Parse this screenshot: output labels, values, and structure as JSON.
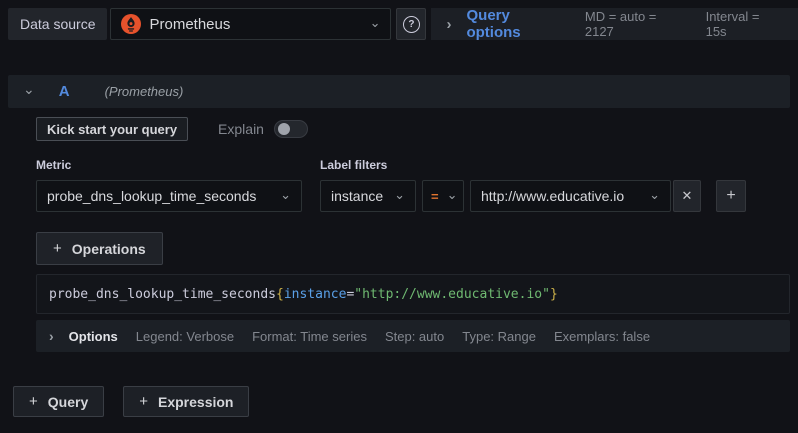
{
  "toolbar": {
    "data_source_label": "Data source",
    "data_source_value": "Prometheus",
    "query_options_label": "Query options",
    "max_data_points": "MD = auto = 2127",
    "interval": "Interval = 15s"
  },
  "query_header": {
    "ref_id": "A",
    "datasource_hint": "(Prometheus)"
  },
  "kickstart": {
    "button_label": "Kick start your query",
    "explain_label": "Explain",
    "explain_enabled": false
  },
  "builder": {
    "metric_label": "Metric",
    "metric_value": "probe_dns_lookup_time_seconds",
    "label_filters_label": "Label filters",
    "filter_name": "instance",
    "filter_operator": "=",
    "filter_value": "http://www.educative.io",
    "operations_label": "Operations"
  },
  "preview": {
    "metric": "probe_dns_lookup_time_seconds",
    "open_brace": "{",
    "label_name": "instance",
    "equals": "=",
    "label_value": "\"http://www.educative.io\"",
    "close_brace": "}"
  },
  "options": {
    "title": "Options",
    "legend": "Legend: Verbose",
    "format": "Format: Time series",
    "step": "Step: auto",
    "type": "Type: Range",
    "exemplars": "Exemplars: false"
  },
  "footer": {
    "query_label": "Query",
    "expression_label": "Expression"
  },
  "icons": {
    "chevron_down": "⌄",
    "chevron_right": "›",
    "close": "✕",
    "plus": "+",
    "help": "?"
  },
  "colors": {
    "accent_blue": "#538ade",
    "operator_orange": "#e0742f",
    "prometheus_orange": "#e6522c",
    "code_label_blue": "#5aa0e8",
    "code_string_green": "#6fb971",
    "code_brace_yellow": "#cdb24a"
  }
}
